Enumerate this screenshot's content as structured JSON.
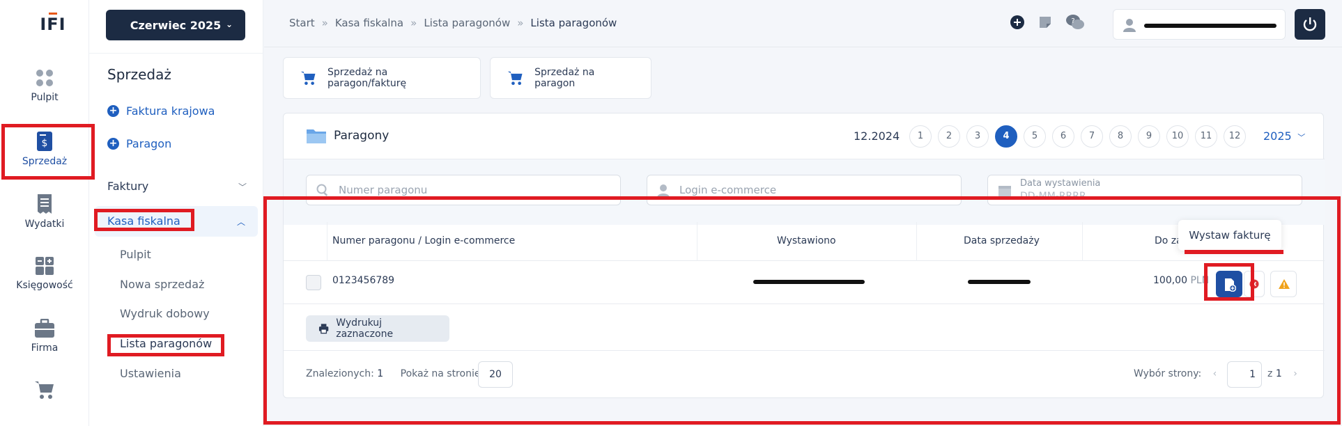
{
  "logo": {
    "text": "IFI"
  },
  "rail": {
    "items": [
      {
        "label": "Pulpit",
        "icon": "grid-dots-icon"
      },
      {
        "label": "Sprzedaż",
        "icon": "receipt-dollar-icon"
      },
      {
        "label": "Wydatki",
        "icon": "receipt-icon"
      },
      {
        "label": "Księgowość",
        "icon": "calculator-icon"
      },
      {
        "label": "Firma",
        "icon": "briefcase-icon"
      },
      {
        "label": "",
        "icon": "cart-icon"
      }
    ]
  },
  "sidebar": {
    "month_button": "Czerwiec 2025",
    "title": "Sprzedaż",
    "links": [
      "Faktura krajowa",
      "Paragon"
    ],
    "group_invoices": "Faktury",
    "group_cash": "Kasa fiskalna",
    "sub_items": [
      "Pulpit",
      "Nowa sprzedaż",
      "Wydruk dobowy",
      "Lista paragonów",
      "Ustawienia"
    ]
  },
  "breadcrumbs": [
    "Start",
    "Kasa fiskalna",
    "Lista paragonów",
    "Lista paragonów"
  ],
  "actions": {
    "sale_receipt_invoice": "Sprzedaż na paragon/fakturę",
    "sale_receipt": "Sprzedaż na paragon"
  },
  "card": {
    "title": "Paragony",
    "period": "12.2024",
    "months": [
      "1",
      "2",
      "3",
      "4",
      "5",
      "6",
      "7",
      "8",
      "9",
      "10",
      "11",
      "12"
    ],
    "selected_month": "4",
    "year": "2025"
  },
  "filters": {
    "receipt_number": "Numer paragonu",
    "login": "Login e-commerce",
    "date_label": "Data wystawienia",
    "date_placeholder": "DD-MM-RRRR"
  },
  "table": {
    "headers": [
      "Numer paragonu / Login e-commerce",
      "Wystawiono",
      "Data sprzedaży",
      "Do za"
    ],
    "rows": [
      {
        "number": "0123456789",
        "amount": "100,00",
        "currency": "PLN"
      }
    ]
  },
  "tooltip": "Wystaw fakturę",
  "print_button": "Wydrukuj zaznaczone",
  "footer": {
    "found_label": "Znalezionych:",
    "found_value": "1",
    "per_page_label": "Pokaż na stronie:",
    "per_page_value": "20",
    "page_label": "Wybór strony:",
    "page_value": "1",
    "of_label": "z",
    "total_pages": "1"
  },
  "colors": {
    "primary": "#1f5fbf",
    "navy": "#1c2b43",
    "annotation": "#e01b22"
  }
}
